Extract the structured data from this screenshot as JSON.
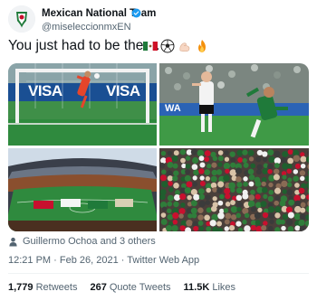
{
  "author": {
    "display_name": "Mexican National Team",
    "handle": "@miseleccionmxEN",
    "verified_icon": "verified-badge-icon",
    "verified_color": "#1d9bf0"
  },
  "tweet": {
    "text": "You just had to be there.",
    "emojis": [
      "mexico-flag-icon",
      "soccer-ball-icon",
      "flexed-biceps-icon",
      "fire-icon"
    ]
  },
  "media": {
    "photos": [
      "goalkeeper-diving-save-photo",
      "players-celebrating-photo",
      "stadium-aerial-photo",
      "fans-in-stands-photo"
    ],
    "banner_text_1": "VISA",
    "banner_text_2": "VISA",
    "banner_text_3": "WA"
  },
  "tagged": {
    "text": "Guillermo Ochoa and 3 others"
  },
  "meta": {
    "text": "12:21 PM · Feb 26, 2021 · Twitter Web App"
  },
  "stats": {
    "retweets_count": "1,779",
    "retweets_label": "Retweets",
    "quotes_count": "267",
    "quotes_label": "Quote Tweets",
    "likes_count": "11.5K",
    "likes_label": "Likes"
  },
  "colors": {
    "text_primary": "#0f1419",
    "text_secondary": "#536471",
    "divider": "#eff3f4",
    "mexico_green": "#1f7a3a"
  }
}
